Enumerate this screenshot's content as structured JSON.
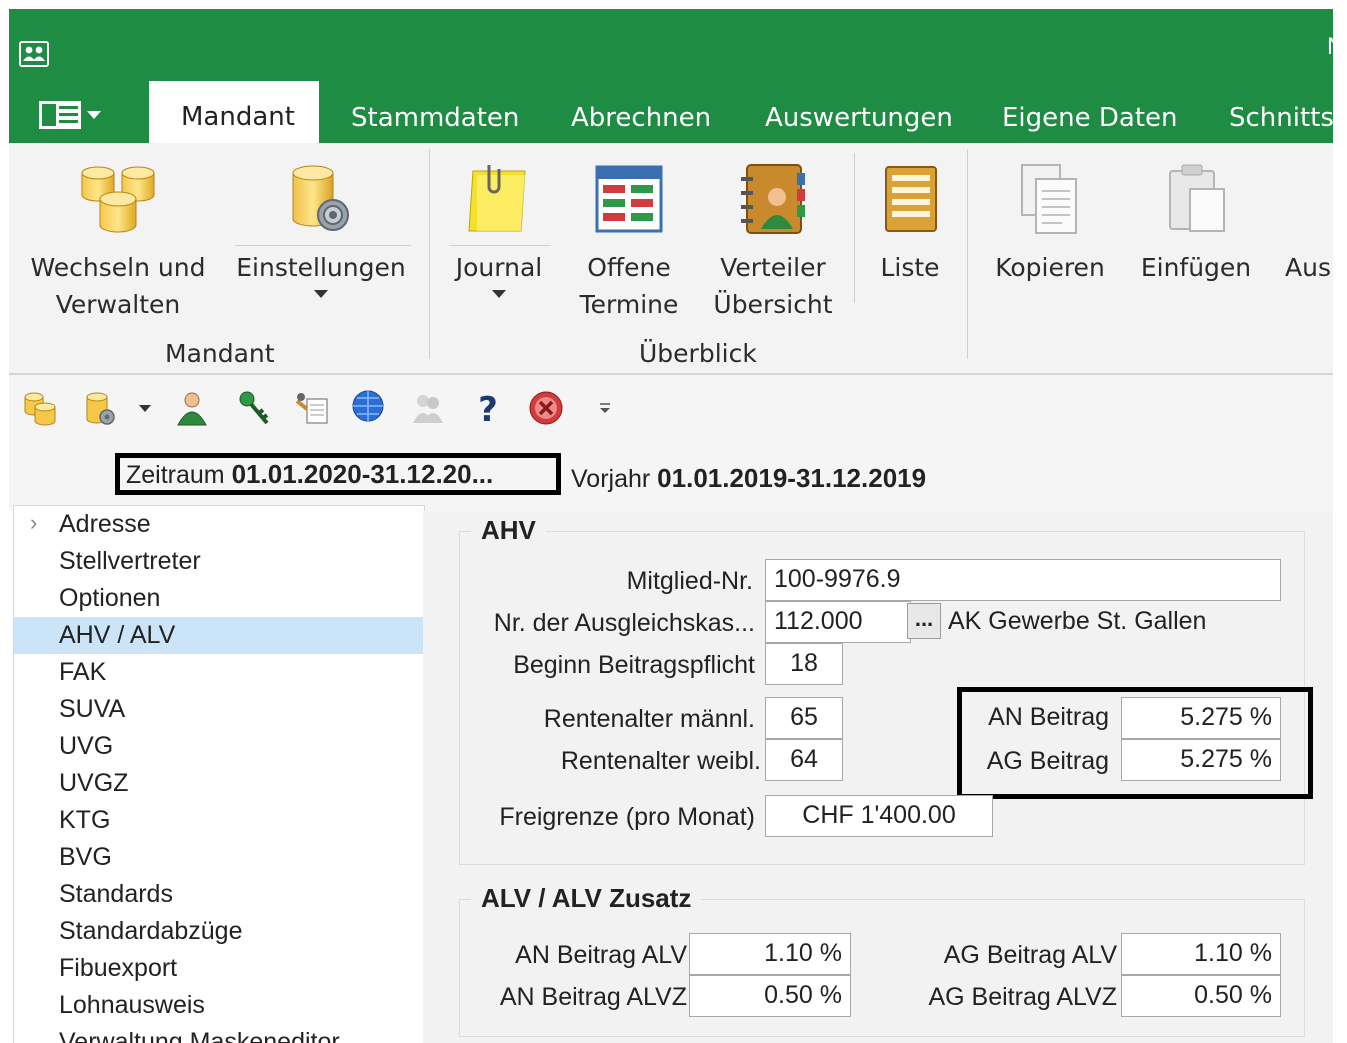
{
  "title_fragment": "N",
  "tabs": [
    {
      "label": "Mandant",
      "active": true
    },
    {
      "label": "Stammdaten"
    },
    {
      "label": "Abrechnen"
    },
    {
      "label": "Auswertungen"
    },
    {
      "label": "Eigene Daten"
    },
    {
      "label": "Schnittst"
    }
  ],
  "ribbon": {
    "mandant": {
      "wechseln": "Wechseln und\nVerwalten",
      "einstellungen": "Einstellungen",
      "group": "Mandant"
    },
    "ueberblick": {
      "journal": "Journal",
      "offene": "Offene\nTermine",
      "verteiler": "Verteiler\nÜbersicht",
      "liste": "Liste",
      "group": "Überblick"
    },
    "clipboard": {
      "kopieren": "Kopieren",
      "einfuegen": "Einfügen",
      "aus": "Aus"
    }
  },
  "period": {
    "label": "Zeitraum",
    "value": "01.01.2020-31.12.20...",
    "prev_label": "Vorjahr",
    "prev_value": "01.01.2019-31.12.2019"
  },
  "nav": {
    "items": [
      "Adresse",
      "Stellvertreter",
      "Optionen",
      "AHV / ALV",
      "FAK",
      "SUVA",
      "UVG",
      "UVGZ",
      "KTG",
      "BVG",
      "Standards",
      "Standardabzüge",
      "Fibuexport",
      "Lohnausweis",
      "Verwaltung Maskeneditor"
    ],
    "selected": "AHV / ALV"
  },
  "ahv": {
    "title": "AHV",
    "mitglied_label": "Mitglied-Nr.",
    "mitglied_value": "100-9976.9",
    "kasse_label": "Nr. der Ausgleichskas...",
    "kasse_value": "112.000",
    "kasse_btn": "...",
    "kasse_name": "AK Gewerbe St. Gallen",
    "beginn_label": "Beginn Beitragspflicht",
    "beginn_value": "18",
    "rente_m_label": "Rentenalter männl.",
    "rente_m_value": "65",
    "rente_w_label": "Rentenalter weibl.",
    "rente_w_value": "64",
    "an_label": "AN Beitrag",
    "an_value": "5.275 %",
    "ag_label": "AG Beitrag",
    "ag_value": "5.275 %",
    "frei_label": "Freigrenze (pro Monat)",
    "frei_value": "CHF 1'400.00"
  },
  "alv": {
    "title": "ALV / ALV Zusatz",
    "an_alv_label": "AN Beitrag ALV",
    "an_alv_value": "1.10 %",
    "an_alvz_label": "AN Beitrag ALVZ",
    "an_alvz_value": "0.50 %",
    "ag_alv_label": "AG Beitrag ALV",
    "ag_alv_value": "1.10 %",
    "ag_alvz_label": "AG Beitrag ALVZ",
    "ag_alvz_value": "0.50 %"
  }
}
